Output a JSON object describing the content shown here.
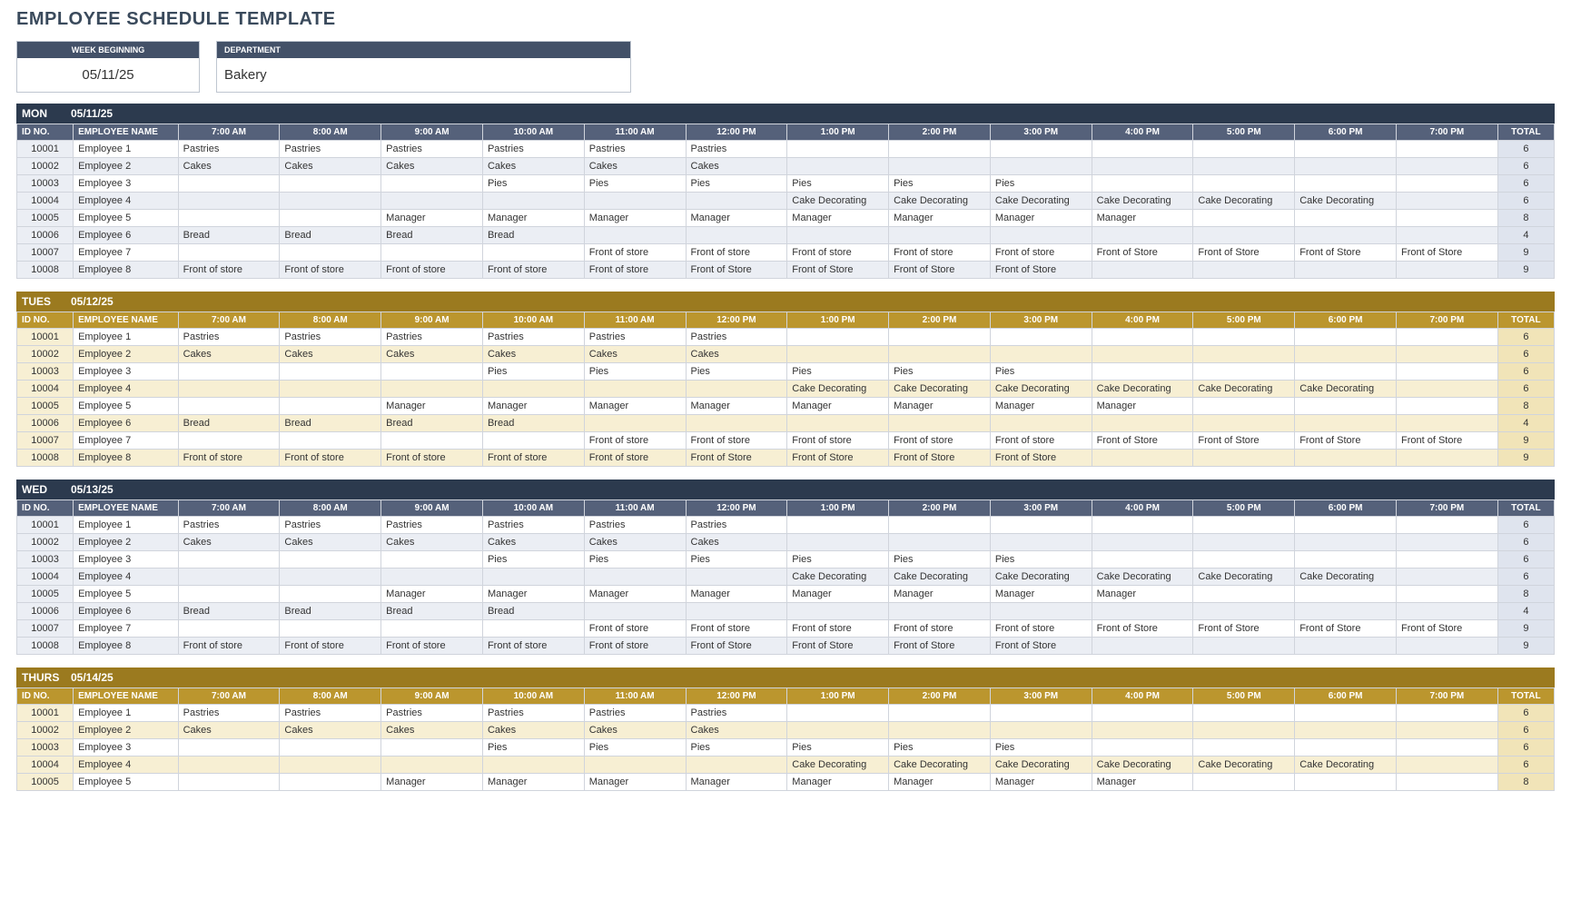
{
  "title": "EMPLOYEE SCHEDULE TEMPLATE",
  "meta": {
    "week_label": "WEEK BEGINNING",
    "week_value": "05/11/25",
    "dept_label": "DEPARTMENT",
    "dept_value": "Bakery"
  },
  "hours": [
    "7:00 AM",
    "8:00 AM",
    "9:00 AM",
    "10:00 AM",
    "11:00 AM",
    "12:00 PM",
    "1:00 PM",
    "2:00 PM",
    "3:00 PM",
    "4:00 PM",
    "5:00 PM",
    "6:00 PM",
    "7:00 PM"
  ],
  "col_id": "ID NO.",
  "col_name": "EMPLOYEE NAME",
  "col_total": "TOTAL",
  "rows": [
    {
      "id": "10001",
      "name": "Employee 1",
      "cells": [
        "Pastries",
        "Pastries",
        "Pastries",
        "Pastries",
        "Pastries",
        "Pastries",
        "",
        "",
        "",
        "",
        "",
        "",
        ""
      ],
      "total": "6"
    },
    {
      "id": "10002",
      "name": "Employee 2",
      "cells": [
        "Cakes",
        "Cakes",
        "Cakes",
        "Cakes",
        "Cakes",
        "Cakes",
        "",
        "",
        "",
        "",
        "",
        "",
        ""
      ],
      "total": "6"
    },
    {
      "id": "10003",
      "name": "Employee 3",
      "cells": [
        "",
        "",
        "",
        "Pies",
        "Pies",
        "Pies",
        "Pies",
        "Pies",
        "Pies",
        "",
        "",
        "",
        ""
      ],
      "total": "6"
    },
    {
      "id": "10004",
      "name": "Employee 4",
      "cells": [
        "",
        "",
        "",
        "",
        "",
        "",
        "Cake Decorating",
        "Cake Decorating",
        "Cake Decorating",
        "Cake Decorating",
        "Cake Decorating",
        "Cake Decorating",
        ""
      ],
      "total": "6"
    },
    {
      "id": "10005",
      "name": "Employee 5",
      "cells": [
        "",
        "",
        "Manager",
        "Manager",
        "Manager",
        "Manager",
        "Manager",
        "Manager",
        "Manager",
        "Manager",
        "",
        "",
        ""
      ],
      "total": "8"
    },
    {
      "id": "10006",
      "name": "Employee 6",
      "cells": [
        "Bread",
        "Bread",
        "Bread",
        "Bread",
        "",
        "",
        "",
        "",
        "",
        "",
        "",
        "",
        ""
      ],
      "total": "4"
    },
    {
      "id": "10007",
      "name": "Employee 7",
      "cells": [
        "",
        "",
        "",
        "",
        "Front of store",
        "Front of store",
        "Front of store",
        "Front of store",
        "Front of store",
        "Front of Store",
        "Front of Store",
        "Front of Store",
        "Front of Store"
      ],
      "total": "9"
    },
    {
      "id": "10008",
      "name": "Employee 8",
      "cells": [
        "Front of store",
        "Front of store",
        "Front of store",
        "Front of store",
        "Front of store",
        "Front of Store",
        "Front of Store",
        "Front of Store",
        "Front of Store",
        "",
        "",
        "",
        ""
      ],
      "total": "9"
    }
  ],
  "days": [
    {
      "name": "MON",
      "date": "05/11/25",
      "theme": "blue",
      "limit": 8
    },
    {
      "name": "TUES",
      "date": "05/12/25",
      "theme": "gold",
      "limit": 8
    },
    {
      "name": "WED",
      "date": "05/13/25",
      "theme": "blue",
      "limit": 8
    },
    {
      "name": "THURS",
      "date": "05/14/25",
      "theme": "gold",
      "limit": 5
    }
  ]
}
